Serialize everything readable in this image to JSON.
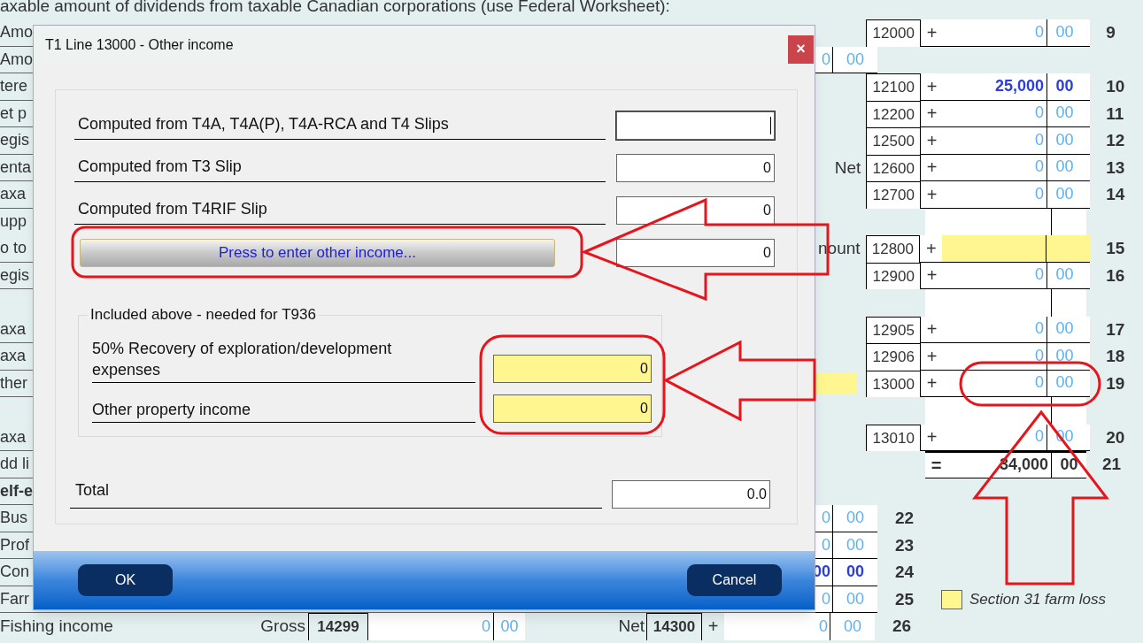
{
  "heading": "axable amount of dividends from taxable Canadian corporations (use Federal Worksheet):",
  "rows": [
    {
      "kind": "entry",
      "label": "Amo",
      "code": "12000",
      "sign": "+",
      "amount": "0",
      "cents": "00",
      "line": "9",
      "entered": false
    },
    {
      "kind": "sub",
      "label": "Amo",
      "amount": "0",
      "cents": "00",
      "entered": false
    },
    {
      "kind": "entry",
      "label": "tere",
      "code": "12100",
      "sign": "+",
      "amount": "25,000",
      "cents": "00",
      "line": "10",
      "entered": true
    },
    {
      "kind": "entry",
      "label": "et p",
      "code": "12200",
      "sign": "+",
      "amount": "0",
      "cents": "00",
      "line": "11",
      "entered": false
    },
    {
      "kind": "entry",
      "label": "egis",
      "code": "12500",
      "sign": "+",
      "amount": "0",
      "cents": "00",
      "line": "12",
      "entered": false
    },
    {
      "kind": "entry",
      "label": "enta",
      "prefix": "Net",
      "code": "12600",
      "sign": "+",
      "amount": "0",
      "cents": "00",
      "line": "13",
      "entered": false
    },
    {
      "kind": "entry",
      "label": "axa",
      "code": "12700",
      "sign": "+",
      "amount": "0",
      "cents": "00",
      "line": "14",
      "entered": false
    },
    {
      "kind": "gap",
      "label": "upp"
    },
    {
      "kind": "entry",
      "label": "o to",
      "prefix": "nount",
      "code": "12800",
      "sign": "+",
      "line": "15",
      "highlighted": true
    },
    {
      "kind": "entry",
      "label": "egis",
      "code": "12900",
      "sign": "+",
      "amount": "0",
      "cents": "00",
      "line": "16",
      "entered": false
    },
    {
      "kind": "gap"
    },
    {
      "kind": "entry",
      "label": "axa",
      "code": "12905",
      "sign": "+",
      "amount": "0",
      "cents": "00",
      "line": "17",
      "entered": false
    },
    {
      "kind": "entry",
      "label": "axa",
      "code": "12906",
      "sign": "+",
      "amount": "0",
      "cents": "00",
      "line": "18",
      "entered": false
    },
    {
      "kind": "entry",
      "label": "ther",
      "farm_loss_marker": true,
      "code": "13000",
      "sign": "+",
      "amount": "0",
      "cents": "00",
      "line": "19",
      "entered": false
    },
    {
      "kind": "gap"
    },
    {
      "kind": "entry",
      "label": "axa",
      "code": "13010",
      "sign": "+",
      "amount": "0",
      "cents": "00",
      "line": "20",
      "entered": false
    },
    {
      "kind": "total",
      "label": "dd li",
      "sign": "=",
      "amount": "34,000",
      "cents": "00",
      "line": "21"
    },
    {
      "kind": "heading",
      "label": "elf-e"
    },
    {
      "kind": "sub",
      "label": "Bus",
      "amount": "0",
      "cents": "00",
      "line": "22",
      "entered": false
    },
    {
      "kind": "sub",
      "label": "Prof",
      "amount": "0",
      "cents": "00",
      "line": "23",
      "entered": false
    },
    {
      "kind": "sub",
      "label": "Con",
      "amount": "00",
      "cents": "00",
      "line": "24",
      "entered": true
    },
    {
      "kind": "sub",
      "label": "Farr",
      "amount": "0",
      "cents": "00",
      "line": "25",
      "entered": false,
      "legend": "Section 31 farm loss"
    },
    {
      "kind": "fishing",
      "label": "Fishing income",
      "gross_label": "Gross",
      "gross_code": "14299",
      "gross_amount": "0",
      "gross_cents": "00",
      "net_label": "Net",
      "code": "14300",
      "sign": "+",
      "amount": "0",
      "cents": "00",
      "line": "26",
      "entered": false
    }
  ],
  "dialog": {
    "title": "T1 Line 13000 - Other income",
    "close": "×",
    "fields": [
      {
        "kind": "input",
        "label": "Computed from T4A, T4A(P), T4A-RCA and T4 Slips",
        "focused": true
      },
      {
        "kind": "input",
        "label": "Computed from T3 Slip",
        "value": "0",
        "focused": false
      },
      {
        "kind": "input",
        "label": "Computed from T4RIF Slip",
        "value": "0",
        "focused": false
      },
      {
        "kind": "button",
        "label": "Press to enter other income...",
        "value": "0",
        "focused": false
      }
    ],
    "group": {
      "title": "Included above - needed for T936",
      "fields": [
        {
          "label": "50% Recovery of exploration/development expenses",
          "value": "0",
          "highlighted": true
        },
        {
          "label": "Other property income",
          "value": "0",
          "highlighted": true
        }
      ]
    },
    "total": {
      "label": "Total",
      "value": "0.0"
    },
    "buttons": [
      {
        "label": "OK"
      },
      {
        "label": "Cancel"
      }
    ]
  }
}
